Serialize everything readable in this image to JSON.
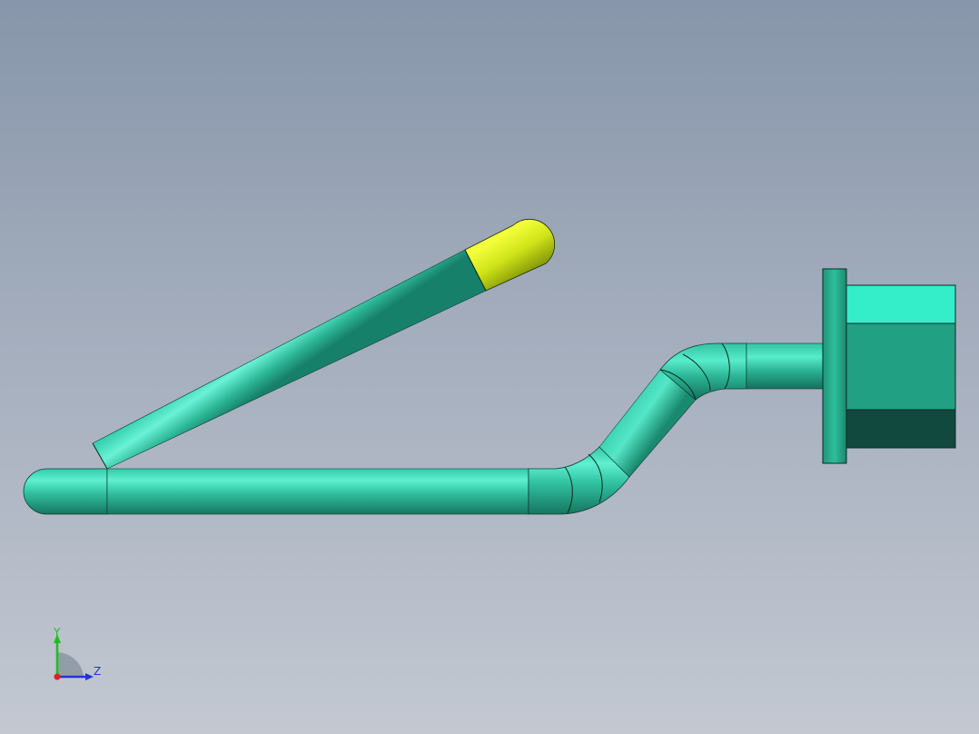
{
  "viewport": {
    "background_top": "#8796aa",
    "background_bottom": "#c3c8d1"
  },
  "model": {
    "tube_color": "#2fd9b0",
    "tube_dark": "#147a63",
    "tip_color": "#d7ee1a",
    "fitting_light": "#33eec8",
    "fitting_mid": "#22a083",
    "fitting_dark": "#11493f"
  },
  "triad": {
    "y_label": "Y",
    "z_label": "Z",
    "y_color": "#22bb22",
    "z_color": "#2233dd",
    "x_color": "#dd2222"
  }
}
